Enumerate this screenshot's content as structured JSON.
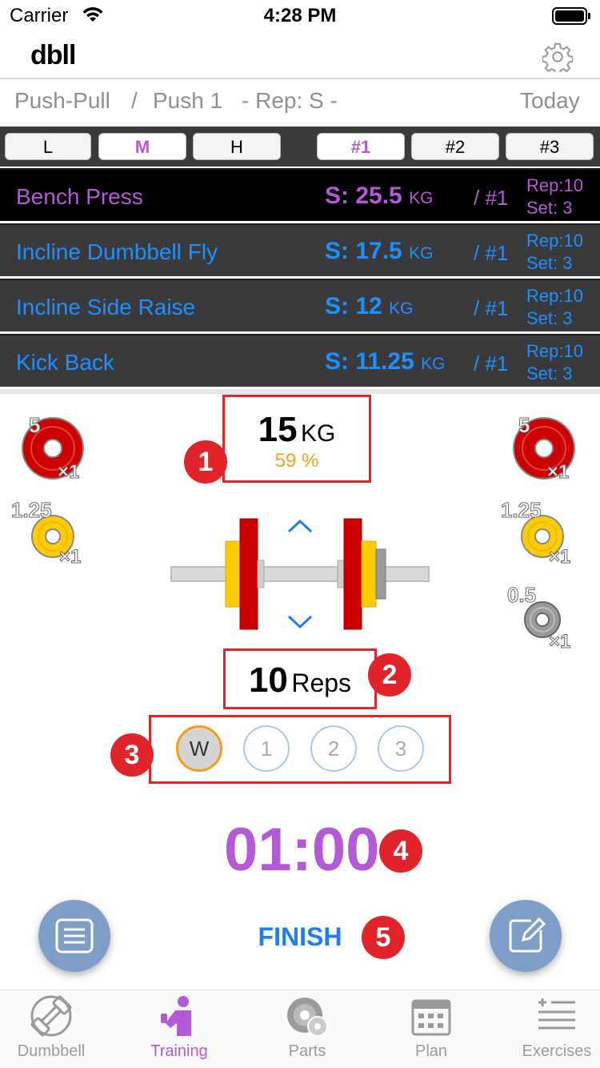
{
  "status_bar": {
    "carrier": "Carrier",
    "time": "4:28 PM"
  },
  "header": {
    "logo": "dbll",
    "settings_icon": "gear-icon"
  },
  "breadcrumb": {
    "program": "Push-Pull",
    "separator": "/",
    "day": "Push 1",
    "rep_mode": "- Rep: S -",
    "date": "Today"
  },
  "intensity_tabs": [
    "L",
    "M",
    "H"
  ],
  "intensity_selected": "M",
  "set_tabs": [
    "#1",
    "#2",
    "#3"
  ],
  "set_selected": "#1",
  "exercises": [
    {
      "name": "Bench Press",
      "weight_prefix": "S:",
      "weight": "25.5",
      "unit": "KG",
      "number": "/ #1",
      "rep": "Rep:10",
      "set": "Set:  3"
    },
    {
      "name": "Incline Dumbbell Fly",
      "weight_prefix": "S:",
      "weight": "17.5",
      "unit": "KG",
      "number": "/ #1",
      "rep": "Rep:10",
      "set": "Set:  3"
    },
    {
      "name": "Incline Side Raise",
      "weight_prefix": "S:",
      "weight": "12",
      "unit": "KG",
      "number": "/ #1",
      "rep": "Rep:10",
      "set": "Set:  3"
    },
    {
      "name": "Kick Back",
      "weight_prefix": "S:",
      "weight": "11.25",
      "unit": "KG",
      "number": "/ #1",
      "rep": "Rep:10",
      "set": "Set:  3"
    }
  ],
  "plates_left": [
    {
      "label": "5",
      "count": "×1",
      "color": "#cc0000"
    },
    {
      "label": "1.25",
      "count": "×1",
      "color": "#ffcc00"
    }
  ],
  "plates_right": [
    {
      "label": "5",
      "count": "×1",
      "color": "#cc0000"
    },
    {
      "label": "1.25",
      "count": "×1",
      "color": "#ffcc00"
    },
    {
      "label": "0.5",
      "count": "×1",
      "color": "#999999"
    }
  ],
  "weight": {
    "value": "15",
    "unit": "KG",
    "percent": "59 %"
  },
  "reps": {
    "value": "10",
    "label": "Reps"
  },
  "sets": [
    "W",
    "1",
    "2",
    "3"
  ],
  "timer": "01:00",
  "finish_label": "FINISH",
  "callouts": [
    "1",
    "2",
    "3",
    "4",
    "5"
  ],
  "tabs": [
    {
      "label": "Dumbbell",
      "icon": "dumbbell-icon"
    },
    {
      "label": "Training",
      "icon": "training-icon"
    },
    {
      "label": "Parts",
      "icon": "parts-icon"
    },
    {
      "label": "Plan",
      "icon": "calendar-icon"
    },
    {
      "label": "Exercises",
      "icon": "exercises-list-icon"
    }
  ],
  "active_tab": "Training",
  "colors": {
    "accent": "#b45ad6",
    "link": "#1e90ff",
    "callout": "#e0242a",
    "plate_red": "#cc0000",
    "plate_yellow": "#ffcc00",
    "plate_gray": "#999999"
  }
}
